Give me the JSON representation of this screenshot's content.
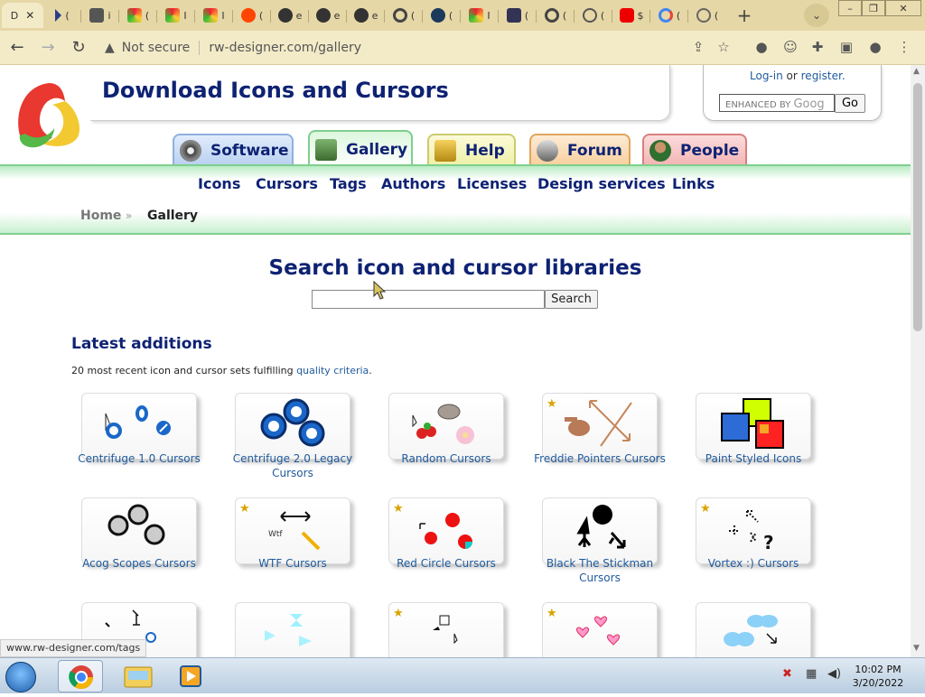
{
  "browser": {
    "tabs": [
      {
        "label": "D",
        "active": true
      },
      {
        "label": "("
      },
      {
        "label": "i"
      },
      {
        "label": "("
      },
      {
        "label": "I"
      },
      {
        "label": "I"
      },
      {
        "label": "("
      },
      {
        "label": "e"
      },
      {
        "label": "e"
      },
      {
        "label": "e"
      },
      {
        "label": "("
      },
      {
        "label": "("
      },
      {
        "label": "I"
      },
      {
        "label": "("
      },
      {
        "label": "("
      },
      {
        "label": "("
      },
      {
        "label": "$"
      },
      {
        "label": "("
      },
      {
        "label": "("
      }
    ],
    "new_tab": "+",
    "address": {
      "security_label": "Not secure",
      "url": "rw-designer.com/gallery"
    },
    "status_url": "www.rw-designer.com/tags"
  },
  "site": {
    "title": "Download Icons and Cursors",
    "login": {
      "login_label": "Log-in",
      "or_text": "or",
      "register_label": "register."
    },
    "google_search": {
      "placeholder": "ENHANCED BY",
      "brand": "Goog",
      "button": "Go"
    },
    "main_tabs": [
      {
        "label": "Software"
      },
      {
        "label": "Gallery"
      },
      {
        "label": "Help"
      },
      {
        "label": "Forum"
      },
      {
        "label": "People"
      }
    ],
    "sub_nav": [
      "Icons",
      "Cursors",
      "Tags",
      "Authors",
      "Licenses",
      "Design services",
      "Links"
    ],
    "breadcrumb": {
      "home": "Home",
      "sep": "»",
      "current": "Gallery"
    }
  },
  "search": {
    "title": "Search icon and cursor libraries",
    "input_value": "",
    "button": "Search"
  },
  "latest": {
    "title": "Latest additions",
    "desc_prefix": "20 most recent icon and cursor sets fulfilling ",
    "desc_link": "quality criteria",
    "desc_suffix": ".",
    "items": [
      {
        "name": "Centrifuge 1.0 Cursors",
        "star": false
      },
      {
        "name": "Centrifuge 2.0 Legacy Cursors",
        "star": false
      },
      {
        "name": "Random Cursors",
        "star": false
      },
      {
        "name": "Freddie Pointers Cursors",
        "star": true
      },
      {
        "name": "Paint Styled Icons",
        "star": false
      },
      {
        "name": "Acog Scopes Cursors",
        "star": false
      },
      {
        "name": "WTF Cursors",
        "star": true
      },
      {
        "name": "Red Circle Cursors",
        "star": true
      },
      {
        "name": "Black The Stickman Cursors",
        "star": false
      },
      {
        "name": "Vortex :) Cursors",
        "star": true
      },
      {
        "name": "",
        "star": false
      },
      {
        "name": "",
        "star": false
      },
      {
        "name": "",
        "star": true
      },
      {
        "name": "",
        "star": true
      },
      {
        "name": "",
        "star": false
      }
    ],
    "wtf_icon_text": "Wtf"
  },
  "taskbar": {
    "time": "10:02 PM",
    "date": "3/20/2022"
  },
  "colors": {
    "title_blue": "#0e2273",
    "link_blue": "#1f5a9c",
    "tab_bar": "#e6d7a6",
    "green_accent": "#7fcf8e"
  }
}
